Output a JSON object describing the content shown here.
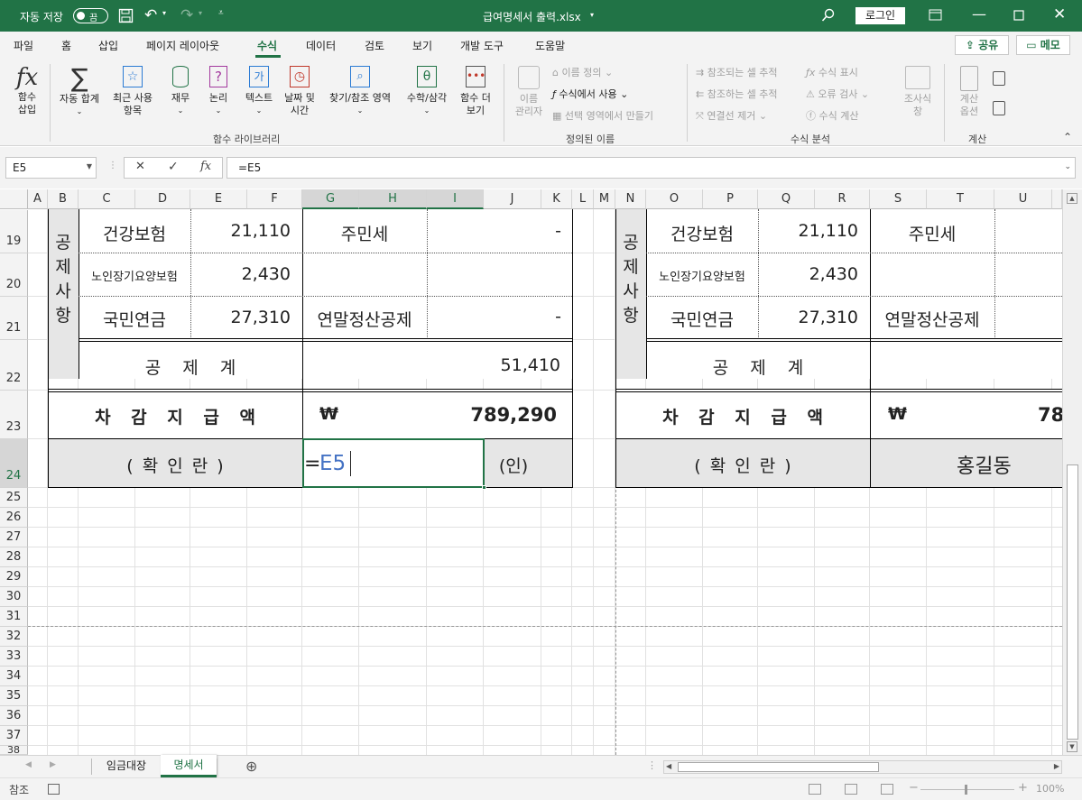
{
  "title": {
    "autosave": "자동 저장",
    "toggle": "끔",
    "filename": "급여명세서 출력.xlsx",
    "login": "로그인"
  },
  "menu": {
    "items": [
      "파일",
      "홈",
      "삽입",
      "페이지 레이아웃",
      "수식",
      "데이터",
      "검토",
      "보기",
      "개발 도구",
      "도움말"
    ],
    "share": "공유",
    "memo": "메모"
  },
  "ribbon": {
    "fx_l1": "함수",
    "fx_l2": "삽입",
    "autosum": "자동 합계",
    "recent_l1": "최근 사용",
    "recent_l2": "항목",
    "fin": "재무",
    "logic": "논리",
    "text": "텍스트",
    "dt_l1": "날짜 및",
    "dt_l2": "시간",
    "lookup": "찾기/참조 영역",
    "math": "수학/삼각",
    "more_l1": "함수 더",
    "more_l2": "보기",
    "g1": "함수 라이브러리",
    "nm_l1": "이름",
    "nm_l2": "관리자",
    "define": "이름 정의",
    "use": "수식에서 사용",
    "create": "선택 영역에서 만들기",
    "g2": "정의된 이름",
    "prec": "참조되는 셀 추적",
    "dep": "참조하는 셀 추적",
    "remove": "연결선 제거",
    "show": "수식 표시",
    "err": "오류 검사",
    "eval": "수식 계산",
    "watch_l1": "조사식",
    "watch_l2": "창",
    "g3": "수식 분석",
    "calc_l1": "계산",
    "calc_l2": "옵션",
    "g4": "계산"
  },
  "formula": {
    "namebox": "E5",
    "cancel": "✕",
    "enter": "✓",
    "fx": "fx",
    "content": "=E5"
  },
  "columns": [
    "A",
    "B",
    "C",
    "D",
    "E",
    "F",
    "G",
    "H",
    "I",
    "J",
    "K",
    "L",
    "M",
    "N",
    "O",
    "P",
    "Q",
    "R",
    "S",
    "T",
    "U"
  ],
  "rows": [
    "19",
    "20",
    "21",
    "22",
    "23",
    "24",
    "25",
    "26",
    "27",
    "28",
    "29",
    "30",
    "31",
    "32",
    "33",
    "34",
    "35",
    "36",
    "37",
    "38"
  ],
  "left": {
    "vlabel": "공\n제\n사\n항",
    "hi": "건강보험",
    "hi_v": "21,110",
    "res": "주민세",
    "res_v": "-",
    "ltc": "노인장기요양보험",
    "ltc_v": "2,430",
    "np": "국민연금",
    "np_v": "27,310",
    "yearend": "연말정산공제",
    "yearend_v": "-",
    "total_l": "공 제 계",
    "total_v": "51,410",
    "net_l": "차 감 지 급 액",
    "won": "₩",
    "net_v": "789,290",
    "confirm": "( 확 인 란 )",
    "edit_eq": "=",
    "edit_ref": "E5",
    "stamp": "(인)"
  },
  "right": {
    "vlabel": "공\n제\n사\n항",
    "hi": "건강보험",
    "hi_v": "21,110",
    "res": "주민세",
    "ltc": "노인장기요양보험",
    "ltc_v": "2,430",
    "np": "국민연금",
    "np_v": "27,310",
    "yearend": "연말정산공제",
    "total_l": "공 제 계",
    "net_l": "차 감 지 급 액",
    "won": "₩",
    "net_v": "78",
    "confirm": "( 확 인 란 )",
    "name": "홍길동"
  },
  "sheets": {
    "tab1": "임금대장",
    "tab2": "명세서"
  },
  "status": {
    "mode": "참조",
    "zoom": "100%"
  },
  "colors": {
    "accent": "#217346",
    "selection": "#217346",
    "ref": "#4472c4"
  }
}
